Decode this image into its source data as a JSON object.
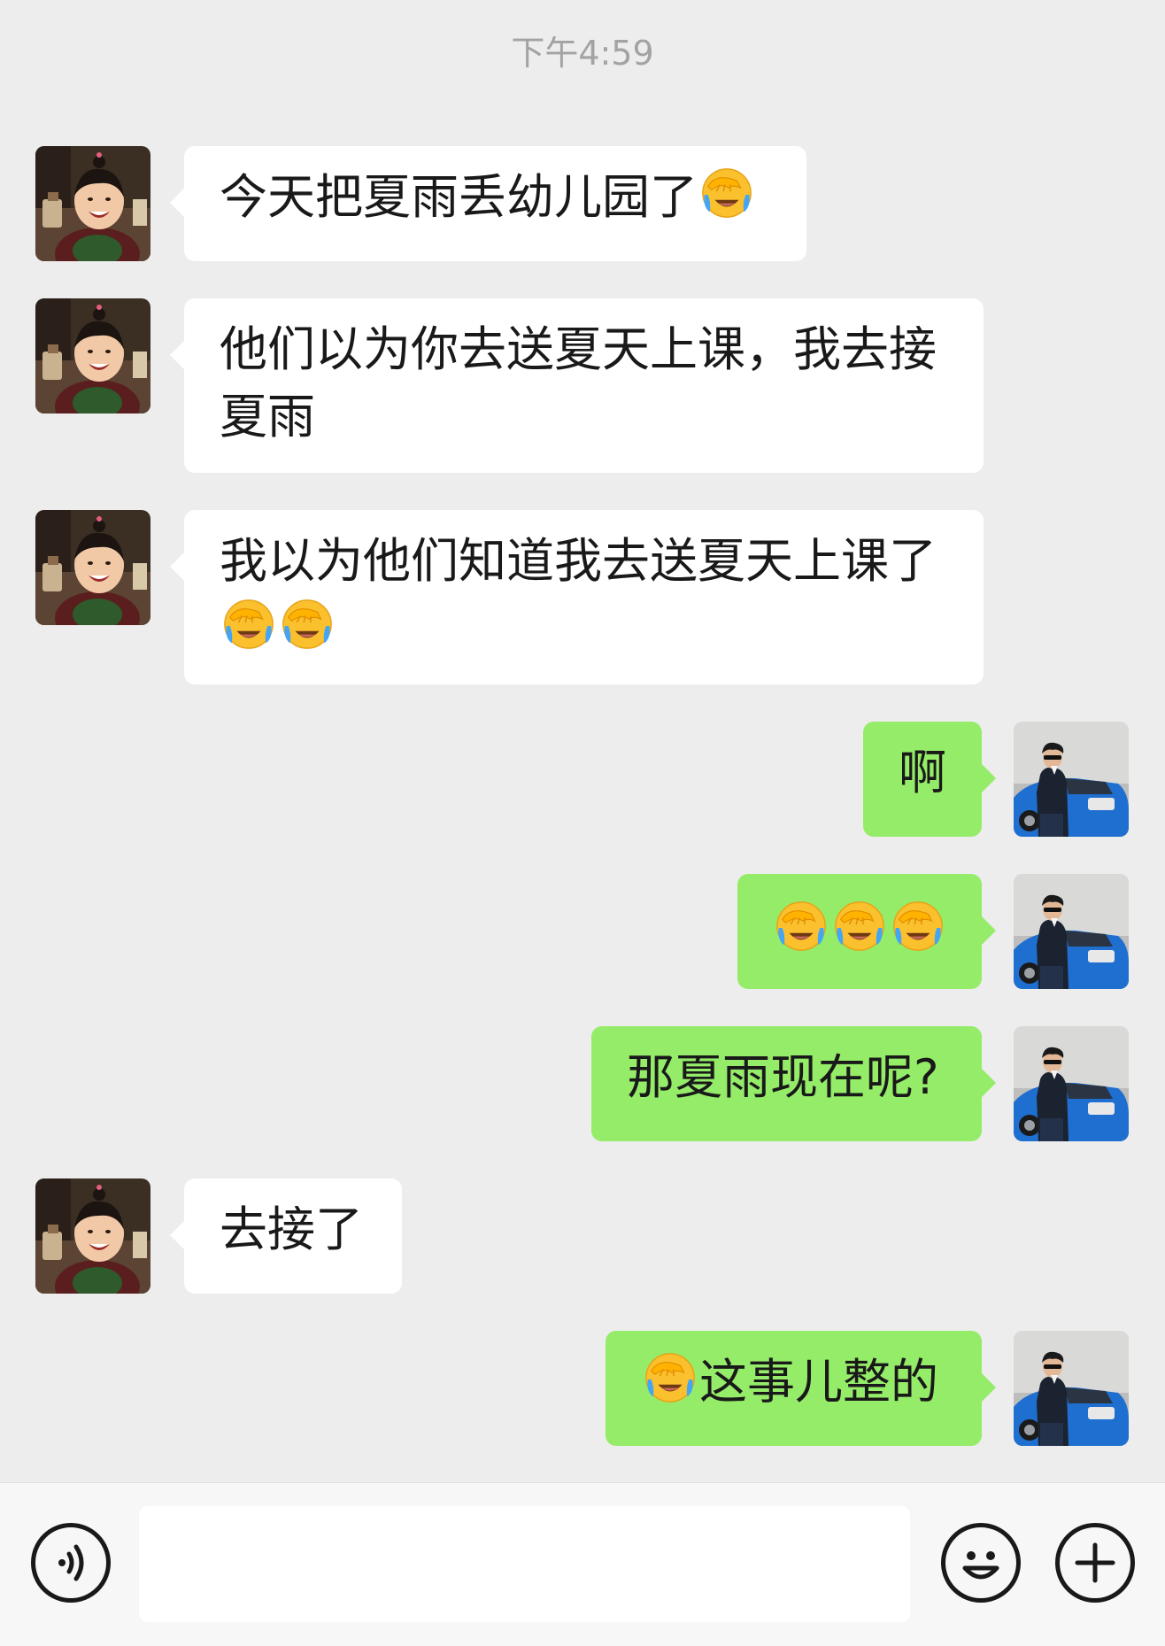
{
  "chat": {
    "timestamp": "下午4:59",
    "messages": [
      {
        "side": "in",
        "text_before": "今天把夏雨丢幼儿园了",
        "emojis": [
          "facepalm-laugh-emoji"
        ],
        "text_after": ""
      },
      {
        "side": "in",
        "line1": "他们以为你去送夏天上课，我去接",
        "line2": "夏雨"
      },
      {
        "side": "in",
        "line1": "我以为他们知道我去送夏天上课了",
        "emojis": [
          "facepalm-laugh-emoji",
          "facepalm-laugh-emoji"
        ]
      },
      {
        "side": "out",
        "text": "啊"
      },
      {
        "side": "out",
        "emojis": [
          "facepalm-laugh-emoji",
          "facepalm-laugh-emoji",
          "facepalm-laugh-emoji"
        ]
      },
      {
        "side": "out",
        "text": "那夏雨现在呢?"
      },
      {
        "side": "in",
        "text": "去接了"
      },
      {
        "side": "out",
        "emojis": [
          "facepalm-laugh-emoji"
        ],
        "text_after": "这事儿整的"
      }
    ]
  },
  "input_bar": {
    "voice_icon": "voice-icon",
    "input_value": "",
    "input_placeholder": "",
    "emoji_icon": "smiley-icon",
    "plus_icon": "plus-icon"
  },
  "colors": {
    "background": "#ededed",
    "incoming_bubble": "#ffffff",
    "outgoing_bubble": "#95ec69",
    "timestamp_text": "#a3a3a3"
  }
}
